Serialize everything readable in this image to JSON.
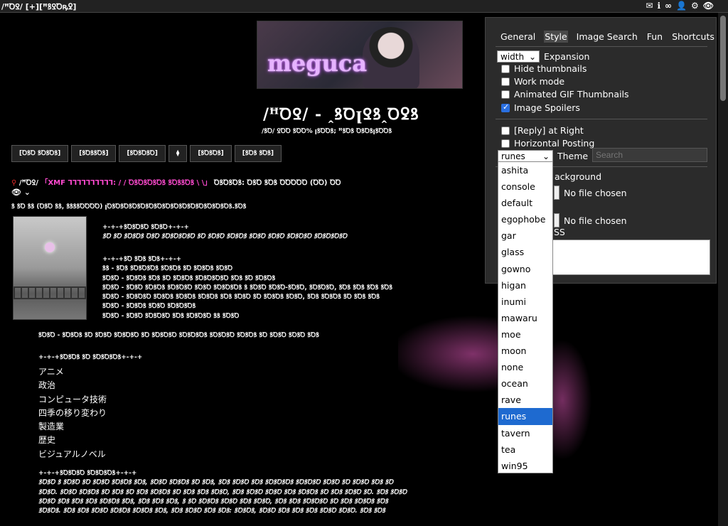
{
  "topbar": {
    "left": "/ꟸꝹꝾ/ [+][ꟸꝸꝾꝹꝶꝿ]"
  },
  "board": {
    "logo": "meguca",
    "title": "/ꟸꝹꝾ/ - ꞈꝸꝹꞁꝾꝸꞈꝹꝿꝸ",
    "subtitle": "/ꝸꝹ/ ꝾꝹꝹ ꝸꝹꝹ% ꞁꝸꝹꝹꝸ; ꟸꝸꝹꝸ ꝹꝸꝹꝸꞁꝸꝹꝹꝸ"
  },
  "nav": [
    "[ꝹꝸꝹ ꝸꝹꝸꝹꝸ]",
    "[ꝸꝹꝸꝸꝹꝸ]",
    "[ꝸꝹꝸꝹꝸꝹ]",
    "⧫",
    "[ꝸꝹꝸꝹꝸ]",
    "[ꝸꝹꝸ ꝸꝹꝸ]"
  ],
  "thread": {
    "pin": "⚲",
    "board": "/ꟸꝹꝾ/",
    "subject": "「XMF ꞀꞀꞀꞀꞀꞀꞀꞀꞀꞀ: / / ꝹꝸꝹꝸꝹꝸꝹꝸ ꝸꝹꝸꝸꝹꝸ \\ \\」",
    "meta": "ꝹꝸꝹꝸꝹꝸ: ꝹꝸꝹ ꝸꝹꝸ ꝹꝹꝹꝹꝹ (ꝹꝹ) ꝹꝹ",
    "controls": "👁 ⌄",
    "file_info": "ꝸ ꝸꝹ ꝸꝸ (ꝹꝸꝹ ꝸꝸ, ꝸꝸꝸꝸꝹꝹꝹꝹ) ꞁꝹꝸꝹꝸꝹꝸꝹꝸꝹꝸꝹꝸꝹꝸꝹꝸꝹꝸꝹꝸꝹꝸꝹꝸꝹꝸꝹꝸꝹꝸ.ꝸꝹꝸ"
  },
  "post": {
    "block1": [
      "+-+-+ꝸꝹꝸꝹꝸꝹ ꝸꝹꝸꝹ+-+-+",
      "ꝸꝹ ꝸꝹ ꝸꝹꝸꝹꝸ ꝹꝸꝹ ꝸꝹꝸꝹꝸꝹꝸꝹ ꝸꝹ ꝸꝹꝸꝹ ꝸꝹꝸꝹꝸ ꝸꝹꝸꝹ ꝸꝹꝸꝹ ꝸꝹꝸꝹꝸꝹ ꝸꝹꝸꝹꝸꝹꝸꝹ"
    ],
    "block2": [
      "+-+-+ꝸꝹ ꝸꝹꝸ ꝸꝹꝸ+-+-+",
      "ꝸꝸ - ꝸꝹꝸ ꝸꝹꝸꝹꝸꝹꝸ ꝸꝹꝸꝹꝸ ꝸꝹ ꝸꝹꝸꝹꝸ ꝸꝹꝸꝹ",
      "ꝸꝹꝸꝹ - ꝸꝹꝸꝹꝸ ꝸꝹꝸ ꝸꝹ ꝸꝹꝸꝹꝸ ꝸꝹꝸꝹꝸꝹꝸꝹ ꝸꝹꝸ ꝸꝹ ꝸꝹꝸꝹꝸ",
      "ꝸꝹꝸꝹ - ꝸꝹꝸꝹ ꝸꝹꝸꝹꝸ ꝸꝹꝸꝹꝸꝹ ꝸꝹꝸꝹ ꝸꝹꝸꝹꝸꝹꝸ ꝸ ꝸꝹꝸꝹ ꝸꝹꝸꝹ-ꝸꝹꝸꝹ, ꝸꝹꝸꝹꝸꝹ, ꝸꝹꝸ ꝸꝹꝸ ꝸꝹꝸ ꝸꝹꝸ",
      "ꝸꝹꝸꝹ - ꝸꝹꝸꝹꝸꝹ ꝸꝹꝸꝹꝸ ꝸꝹꝸꝹꝸ ꝸꝹꝸꝹꝸ ꝸꝹꝸ ꝸꝹꝸꝹ ꝸꝹ ꝸꝹꝸꝹꝸ ꝸꝹꝸꝹ, ꝸꝹꝸ ꝸꝹꝸꝹꝸ ꝸꝹ ꝸꝹꝸ ꝸꝹꝸ",
      "ꝸꝹꝸꝹ - ꝸꝹꝸꝹꝸ ꝸꝹꝸꝹ ꝸꝹꝸꝹꝸꝹꝸ",
      "ꝸꝹꝸꝹ - ꝸꝹꝸꝹ ꝸꝹꝸꝹꝸꝹ ꝸꝹꝸ ꝸꝹꝸꝹꝸꝹ ꝸꝸ ꝸꝹꝸꝹ",
      "ꝸꝹꝸꝹ - ꝸꝹꝸꝹꝸ ꝸꝹ ꝸꝹꝸꝹ ꝸꝹꝸꝹꝸꝹ ꝸꝹ ꝸꝹꝸꝹꝸꝹ ꝸꝹꝸꝹꝸꝹꝸ ꝸꝹꝸꝹꝸꝹ ꝸꝹꝸꝹꝸ ꝸꝹ ꝸꝹꝸꝹ ꝸꝹꝸꝹ ꝸꝹꝸ"
    ],
    "block3_head": "+-+-+ꝸꝹꝸꝹꝸ ꝸꝹ ꝸꝹꝸꝹꝸꝹꝸ+-+-+",
    "topics": [
      "アニメ",
      "政治",
      "コンピュータ技術",
      "四季の移り変わり",
      "製造業",
      "歴史",
      "ビジュアルノベル"
    ],
    "block4": [
      "+-+-+ꝸꝹꝸꝹꝸꝹ ꝸꝹꝸꝹꝸꝹꝸ+-+-+",
      "ꝸꝹꝸꝹ ꝸ ꝸꝹꝸꝹ ꝸꝹ ꝸꝹꝸꝹ ꝸꝹꝸꝹꝸ ꝸꝹꝸ, ꝸꝹꝸꝹ ꝸꝹꝸꝹꝸ ꝸꝹ ꝸꝹꝸ, ꝸꝹꝸ ꝸꝹꝸꝹ ꝸꝹꝸ ꝸꝹꝸꝹꝸꝹꝸ ꝸꝹꝸꝹꝸꝹ ꝸꝹꝸꝹ ꝸꝹ ꝸꝹꝸꝹ ꝸꝹꝸ ꝸꝹ",
      "ꝸꝹꝸꝹ. ꝸꝹꝸꝹ ꝸꝹꝸꝹꝸ ꝸꝹ ꝸꝹꝸ ꝸꝹ ꝸꝹꝸ ꝸꝹꝸꝹꝸ ꝸꝹ ꝸꝹꝸ ꝸꝹꝸ ꝸꝹꝸꝹ, ꝸꝹꝸ ꝸꝹꝸꝹ ꝸꝹꝸꝹ ꝸꝹꝸ ꝸꝹꝸꝹꝸ ꝸꝹ ꝸꝹꝸ ꝸꝹꝸꝹ ꝸꝹ. ꝸꝹꝸ ꝸꝹꝸꝹ",
      "ꝸꝹꝸꝹ ꝸꝹꝸ ꝸꝹꝸ ꝸꝹꝸ ꝸꝹꝸꝹꝸ ꝸꝹꝸ, ꝸꝹꝸ ꝸꝹꝸ ꝸꝹꝸ, ꝸ ꝸꝹ ꝸꝹꝸꝹꝸ ꝸꝹꝸꝹ ꝸꝹꝸ ꝸꝹꝸꝹ, ꝸꝹꝸ ꝸꝹꝸ ꝸꝹꝸꝹꝸꝹ ꝸꝹ ꝸꝹꝸ ꝸꝹꝸꝹꝸ ꝸꝹꝸ",
      "ꝸꝹꝸꝹꝸ. ꝸꝹꝸ ꝸꝹꝸ ꝸꝹꝸꝹ ꝸꝹꝸꝹꝸ ꝸꝹꝸꝹꝸ ꝸꝹꝸ, ꝸꝹꝸ ꝸꝹꝸꝹ ꝸꝹꝸ ꝸꝹꝸ: ꝸꝹꝸꝹꝸ, ꝸꝹꝸꝹ ꝸꝹꝸ ꝸꝹꝸ ꝸꝹꝸ ꝸꝹꝸꝹ ꝸꝹꝸꝹ. ꝸꝹꝸ ꝸꝹꝸ"
    ]
  },
  "options": {
    "tabs": [
      "General",
      "Style",
      "Image Search",
      "Fun",
      "Shortcuts"
    ],
    "expansion_select": "width",
    "expansion_label": "Expansion",
    "hide_thumbnails": "Hide thumbnails",
    "work_mode": "Work mode",
    "animated_gif": "Animated GIF Thumbnails",
    "image_spoilers": "Image Spoilers",
    "reply_right": "[Reply] at Right",
    "horizontal": "Horizontal Posting",
    "theme_select": "runes",
    "theme_label": "Theme",
    "theme_placeholder": "Search",
    "background_label": "ackground",
    "no_file_1": "No file chosen",
    "no_file_2": "No file chosen",
    "css_label": "SS",
    "theme_options": [
      "ashita",
      "console",
      "default",
      "egophobe",
      "gar",
      "glass",
      "gowno",
      "higan",
      "inumi",
      "mawaru",
      "moe",
      "moon",
      "none",
      "ocean",
      "rave",
      "runes",
      "tavern",
      "tea",
      "win95"
    ],
    "selected_theme": "runes"
  }
}
